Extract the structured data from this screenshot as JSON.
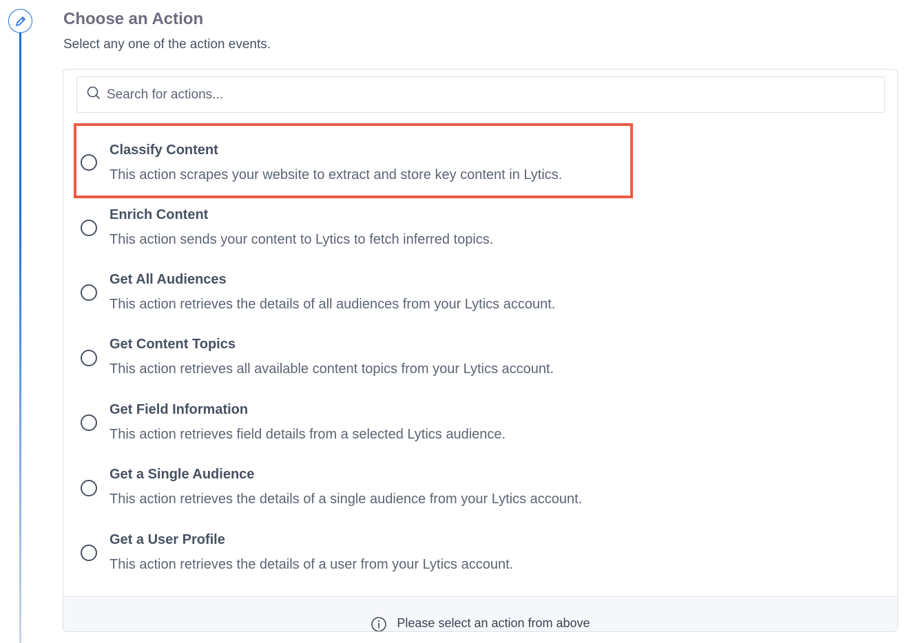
{
  "header": {
    "title": "Choose an Action",
    "subtitle": "Select any one of the action events."
  },
  "step_icon": "pencil-icon",
  "search": {
    "placeholder": "Search for actions...",
    "icon": "search-icon"
  },
  "actions": [
    {
      "title": "Classify Content",
      "description": "This action scrapes your website to extract and store key content in Lytics.",
      "highlighted": true
    },
    {
      "title": "Enrich Content",
      "description": "This action sends your content to Lytics to fetch inferred topics."
    },
    {
      "title": "Get All Audiences",
      "description": "This action retrieves the details of all audiences from your Lytics account."
    },
    {
      "title": "Get Content Topics",
      "description": "This action retrieves all available content topics from your Lytics account."
    },
    {
      "title": "Get Field Information",
      "description": "This action retrieves field details from a selected Lytics audience."
    },
    {
      "title": "Get a Single Audience",
      "description": "This action retrieves the details of a single audience from your Lytics account."
    },
    {
      "title": "Get a User Profile",
      "description": "This action retrieves the details of a user from your Lytics account."
    }
  ],
  "footer": {
    "icon": "info-icon",
    "message": "Please select an action from above"
  },
  "colors": {
    "accent": "#1e6fd9",
    "highlight": "#ef5a44"
  }
}
